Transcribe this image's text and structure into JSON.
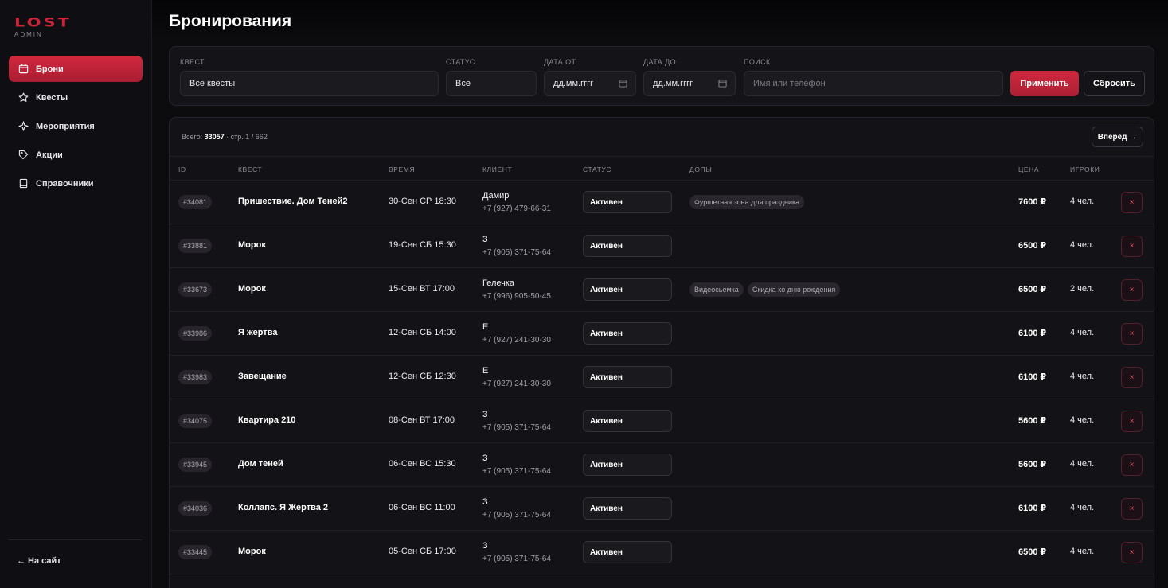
{
  "brand": {
    "logo": "LOST",
    "subtitle": "ADMIN",
    "accent": "#c8243a"
  },
  "sidebar": {
    "items": [
      {
        "label": "Брони",
        "icon": "calendar-icon",
        "active": true
      },
      {
        "label": "Квесты",
        "icon": "star-icon",
        "active": false
      },
      {
        "label": "Мероприятия",
        "icon": "sparkle-icon",
        "active": false
      },
      {
        "label": "Акции",
        "icon": "tag-icon",
        "active": false
      },
      {
        "label": "Справочники",
        "icon": "book-icon",
        "active": false
      }
    ],
    "back_link": "← На сайт"
  },
  "page": {
    "title": "Бронирования"
  },
  "filters": {
    "quest": {
      "label": "КВЕСТ",
      "value": "Все квесты"
    },
    "status": {
      "label": "СТАТУС",
      "value": "Все"
    },
    "date_from": {
      "label": "ДАТА ОТ",
      "value": "дд.мм.гггг"
    },
    "date_to": {
      "label": "ДАТА ДО",
      "value": "дд.мм.гггг"
    },
    "search": {
      "label": "ПОИСК",
      "placeholder": "Имя или телефон"
    },
    "apply_label": "Применить",
    "reset_label": "Сбросить"
  },
  "summary": {
    "prefix": "Всего:",
    "total": "33057",
    "page_info": "· стр. 1 / 662"
  },
  "pagination": {
    "next_label": "Вперёд →"
  },
  "table": {
    "columns": {
      "id": "ID",
      "quest": "КВЕСТ",
      "time": "ВРЕМЯ",
      "client": "КЛИЕНТ",
      "status": "СТАТУС",
      "extras": "ДОПЫ",
      "price": "ЦЕНА",
      "players": "ИГРОКИ"
    },
    "rows": [
      {
        "id": "#34081",
        "quest": "Пришествие. Дом Теней2",
        "time": "30-Сен СР 18:30",
        "client_name": "Дамир",
        "client_phone": "+7 (927) 479-66-31",
        "status": "Активен",
        "extras": [
          "Фуршетная зона для праздника"
        ],
        "price": "7600 ₽",
        "players": "4 чел."
      },
      {
        "id": "#33881",
        "quest": "Морок",
        "time": "19-Сен СБ 15:30",
        "client_name": "З",
        "client_phone": "+7 (905) 371-75-64",
        "status": "Активен",
        "extras": [],
        "price": "6500 ₽",
        "players": "4 чел."
      },
      {
        "id": "#33673",
        "quest": "Морок",
        "time": "15-Сен ВТ 17:00",
        "client_name": "Гелечка",
        "client_phone": "+7 (996) 905-50-45",
        "status": "Активен",
        "extras": [
          "Видеосьемка",
          "Скидка ко дню рождения"
        ],
        "price": "6500 ₽",
        "players": "2 чел."
      },
      {
        "id": "#33986",
        "quest": "Я жертва",
        "time": "12-Сен СБ 14:00",
        "client_name": "Е",
        "client_phone": "+7 (927) 241-30-30",
        "status": "Активен",
        "extras": [],
        "price": "6100 ₽",
        "players": "4 чел."
      },
      {
        "id": "#33983",
        "quest": "Завещание",
        "time": "12-Сен СБ 12:30",
        "client_name": "Е",
        "client_phone": "+7 (927) 241-30-30",
        "status": "Активен",
        "extras": [],
        "price": "6100 ₽",
        "players": "4 чел."
      },
      {
        "id": "#34075",
        "quest": "Квартира 210",
        "time": "08-Сен ВТ 17:00",
        "client_name": "З",
        "client_phone": "+7 (905) 371-75-64",
        "status": "Активен",
        "extras": [],
        "price": "5600 ₽",
        "players": "4 чел."
      },
      {
        "id": "#33945",
        "quest": "Дом теней",
        "time": "06-Сен ВС 15:30",
        "client_name": "З",
        "client_phone": "+7 (905) 371-75-64",
        "status": "Активен",
        "extras": [],
        "price": "5600 ₽",
        "players": "4 чел."
      },
      {
        "id": "#34036",
        "quest": "Коллапс. Я Жертва 2",
        "time": "06-Сен ВС 11:00",
        "client_name": "З",
        "client_phone": "+7 (905) 371-75-64",
        "status": "Активен",
        "extras": [],
        "price": "6100 ₽",
        "players": "4 чел."
      },
      {
        "id": "#33445",
        "quest": "Морок",
        "time": "05-Сен СБ 17:00",
        "client_name": "З",
        "client_phone": "+7 (905) 371-75-64",
        "status": "Активен",
        "extras": [],
        "price": "6500 ₽",
        "players": "4 чел."
      }
    ],
    "delete_glyph": "×"
  }
}
